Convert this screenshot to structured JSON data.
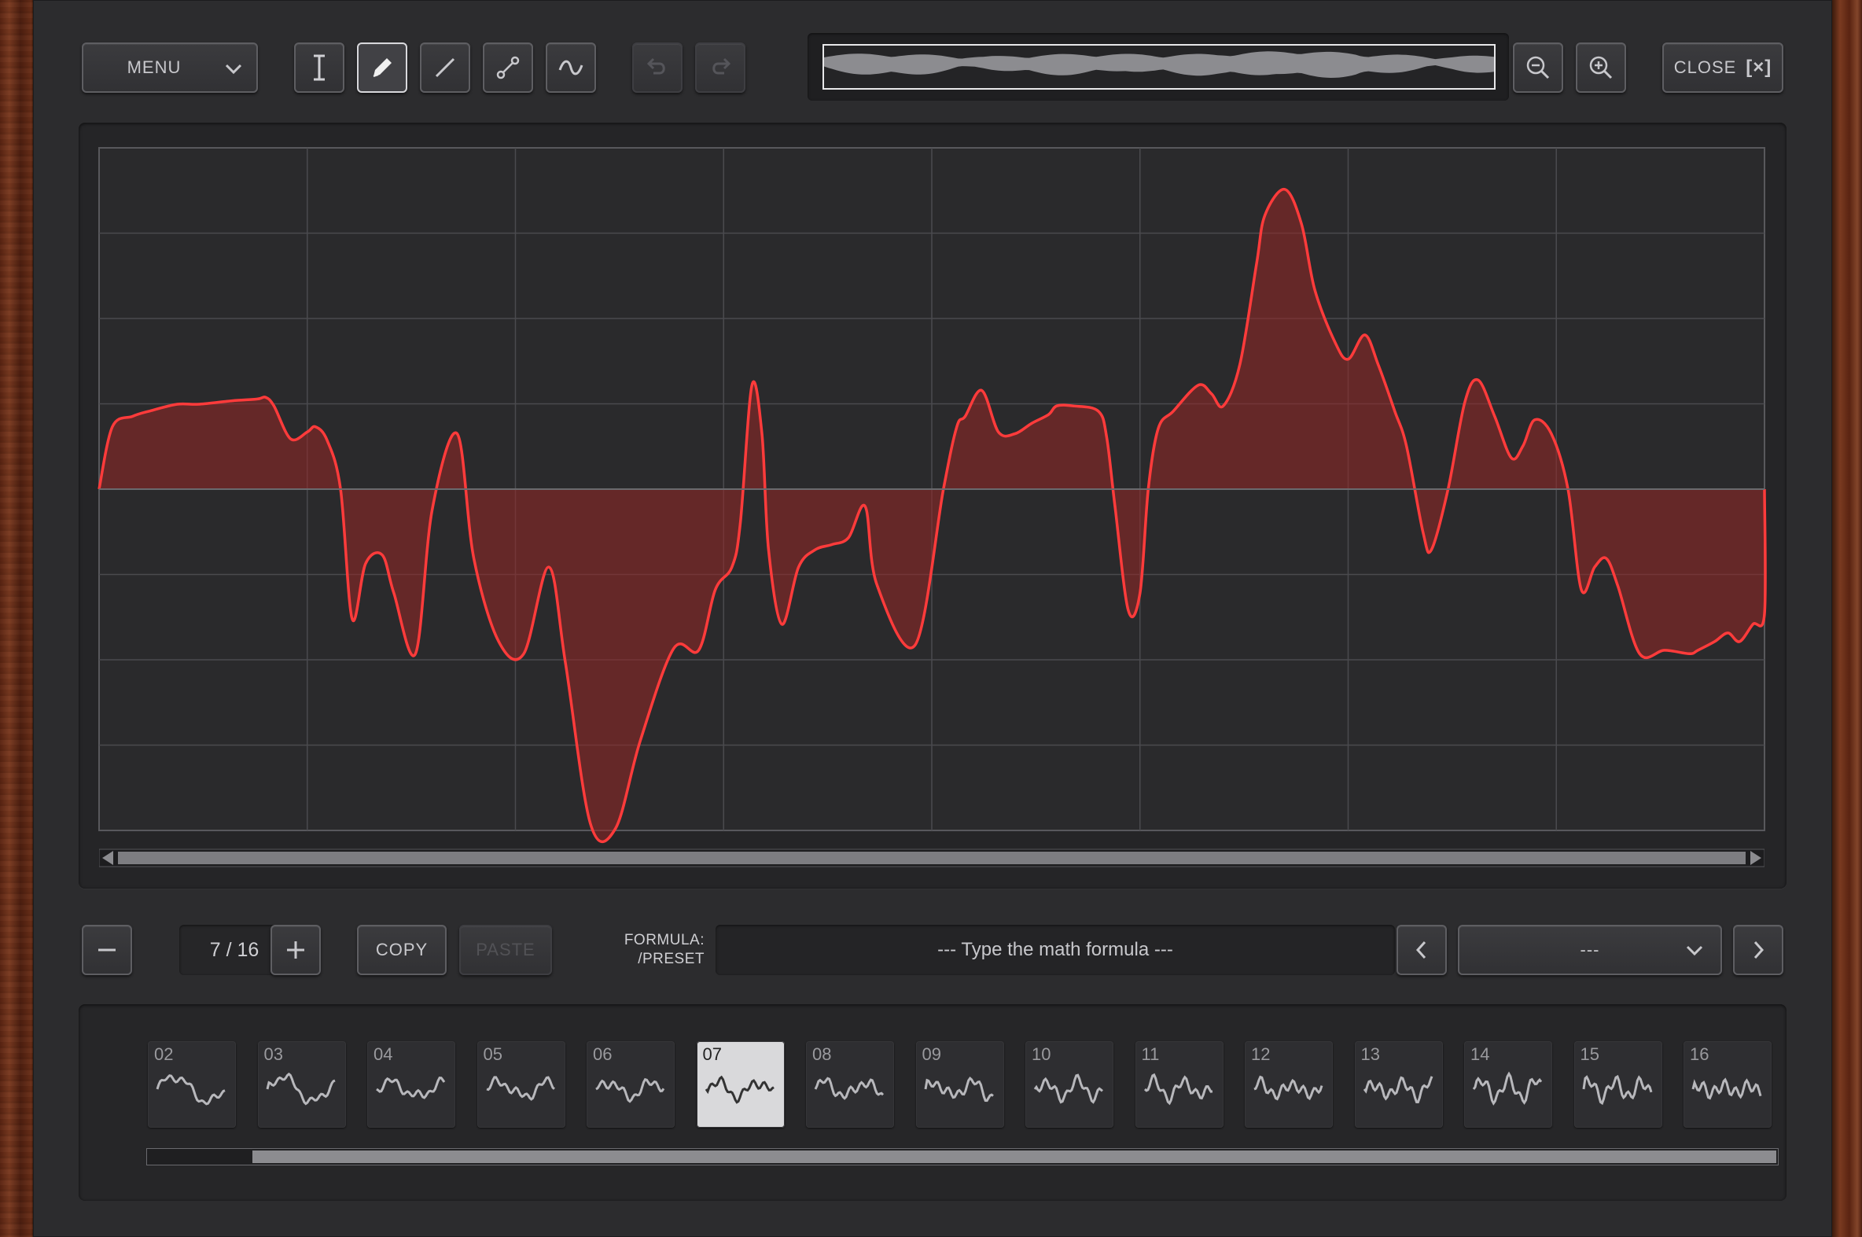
{
  "toolbar": {
    "menu_label": "MENU",
    "close_label": "CLOSE",
    "close_box": "[×]",
    "tools": [
      {
        "name": "text-cursor-tool",
        "icon": "i-beam-icon",
        "active": false
      },
      {
        "name": "pencil-tool",
        "icon": "pencil-icon",
        "active": true
      },
      {
        "name": "line-tool",
        "icon": "line-icon",
        "active": false
      },
      {
        "name": "curve-tool",
        "icon": "bezier-icon",
        "active": false
      },
      {
        "name": "smooth-tool",
        "icon": "sine-icon",
        "active": false
      }
    ]
  },
  "editor": {
    "wave_color": "#ff3b3b",
    "fill_color": "rgba(150,38,38,0.55)",
    "grid_color": "#4a4a4e",
    "grid_columns": 8,
    "grid_rows": 8
  },
  "frames": {
    "counter_text": "7 / 16",
    "current": 7,
    "total": 16,
    "copy_label": "COPY",
    "paste_label": "PASTE"
  },
  "formula": {
    "label_line1": "FORMULA:",
    "label_line2": "/PRESET",
    "placeholder": "--- Type the math formula ---",
    "preset_value": "---"
  },
  "thumbnails": [
    "02",
    "03",
    "04",
    "05",
    "06",
    "07",
    "08",
    "09",
    "10",
    "11",
    "12",
    "13",
    "14",
    "15",
    "16"
  ],
  "selected_thumbnail": "07"
}
